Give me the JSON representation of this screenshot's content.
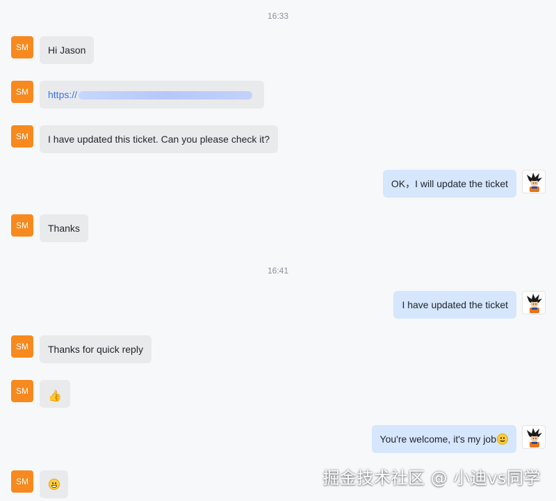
{
  "timestamps": [
    "16:33",
    "16:41"
  ],
  "contact_initials": "SM",
  "messages": {
    "m1": "Hi Jason",
    "m2_link": "https://",
    "m3": "I have updated this ticket. Can you please check it?",
    "m4": "OK，I will update the ticket",
    "m5": "Thanks",
    "m6": "I have updated the ticket",
    "m7": "Thanks for quick reply",
    "m8_emoji": "thumbs-up",
    "m9": "You're welcome, it's my job",
    "m9_emoji": "smiling-face",
    "m10_emoji": "grinning-face"
  },
  "watermark": "掘金技术社区 @ 小迪vs同学",
  "colors": {
    "background": "#f7f8fa",
    "incoming_bubble": "#e9eaec",
    "outgoing_bubble": "#d5e6fd",
    "avatar": "#f7891e",
    "link": "#3370ff"
  }
}
